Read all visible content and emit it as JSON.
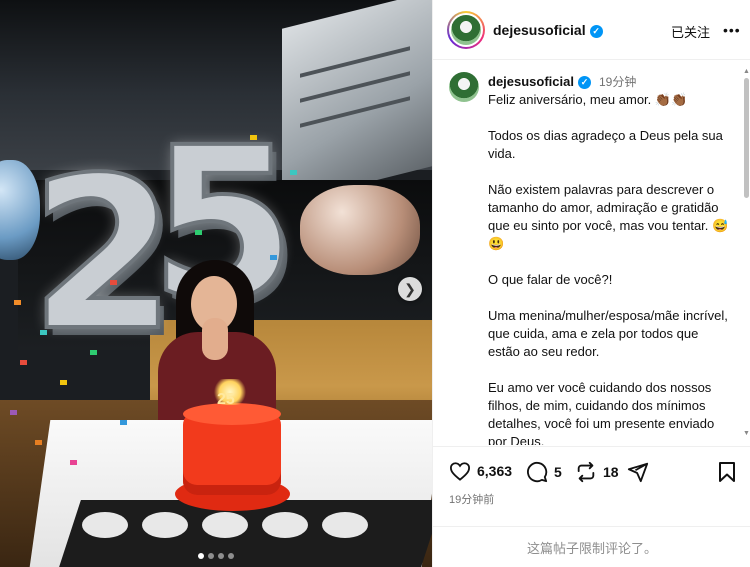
{
  "photo": {
    "balloon_digit_1": "2",
    "balloon_digit_2": "5",
    "candle_number": "25",
    "next_icon": "chevron-right-icon",
    "carousel_total": 4,
    "carousel_active": 1
  },
  "header": {
    "username": "dejesusoficial",
    "verified_icon": "verified-badge-icon",
    "follow_state": "已关注",
    "more_icon": "ellipsis-icon"
  },
  "caption": {
    "username": "dejesusoficial",
    "time": "19分钟",
    "lines": [
      "Feliz aniversário, meu amor. 👏🏾👏🏾",
      "Todos os dias agradeço a Deus pela sua vida.",
      "Não existem palavras para descrever o tamanho do amor, admiração e gratidão que eu sinto por você, mas vou tentar. 😅😃",
      "O que falar de você?!",
      "Uma menina/mulher/esposa/mãe incrível, que cuida, ama e zela por todos que estão ao seu redor.",
      "Eu amo ver você cuidando dos nossos filhos, de mim, cuidando dos mínimos detalhes, você foi um presente enviado por Deus."
    ]
  },
  "actions": {
    "like_count": "6,363",
    "comment_count": "5",
    "repost_count": "18",
    "like_icon": "heart-icon",
    "comment_icon": "comment-bubble-icon",
    "repost_icon": "repost-icon",
    "share_icon": "send-icon",
    "save_icon": "bookmark-icon"
  },
  "timestamp": "19分钟前",
  "comment_notice": "这篇帖子限制评论了。",
  "colors": {
    "verified": "#0095f6",
    "cake": "#f23a1c",
    "dress": "#6b1d22"
  }
}
